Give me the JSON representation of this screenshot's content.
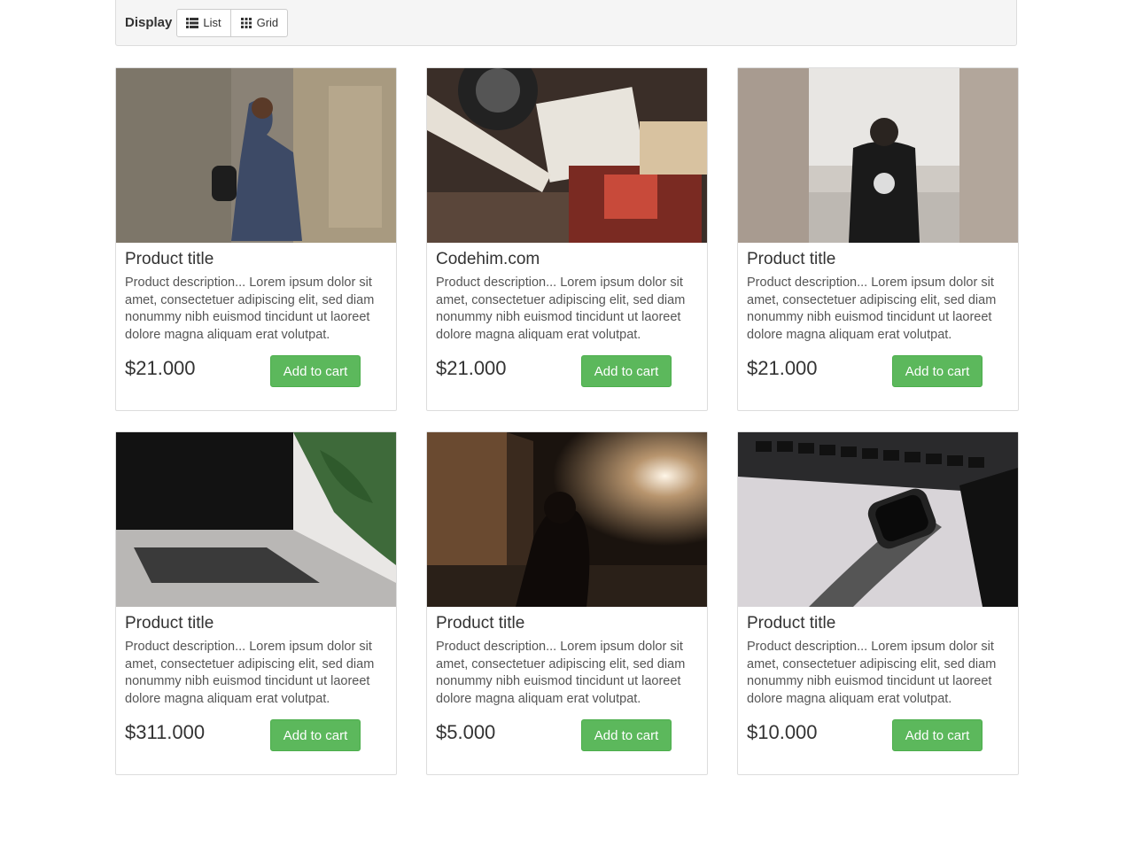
{
  "toolbar": {
    "label": "Display",
    "list_label": "List",
    "grid_label": "Grid",
    "list_icon": "list-icon",
    "grid_icon": "grid-icon"
  },
  "colors": {
    "accent_green": "#5cb85c",
    "toolbar_bg": "#f5f5f5",
    "border": "#dddddd"
  },
  "products": [
    {
      "title": "Product title",
      "description": "Product description... Lorem ipsum dolor sit amet, consectetuer adipiscing elit, sed diam nonummy nibh euismod tincidunt ut laoreet dolore magna aliquam erat volutpat.",
      "price": "$21.000",
      "button": "Add to cart",
      "image": "woman-taking-photo"
    },
    {
      "title": "Codehim.com",
      "description": "Product description... Lorem ipsum dolor sit amet, consectetuer adipiscing elit, sed diam nonummy nibh euismod tincidunt ut laoreet dolore magna aliquam erat volutpat.",
      "price": "$21.000",
      "button": "Add to cart",
      "image": "vinyl-records"
    },
    {
      "title": "Product title",
      "description": "Product description... Lorem ipsum dolor sit amet, consectetuer adipiscing elit, sed diam nonummy nibh euismod tincidunt ut laoreet dolore magna aliquam erat volutpat.",
      "price": "$21.000",
      "button": "Add to cart",
      "image": "man-in-corridor"
    },
    {
      "title": "Product title",
      "description": "Product description... Lorem ipsum dolor sit amet, consectetuer adipiscing elit, sed diam nonummy nibh euismod tincidunt ut laoreet dolore magna aliquam erat volutpat.",
      "price": "$311.000",
      "button": "Add to cart",
      "image": "laptop-and-plant"
    },
    {
      "title": "Product title",
      "description": "Product description... Lorem ipsum dolor sit amet, consectetuer adipiscing elit, sed diam nonummy nibh euismod tincidunt ut laoreet dolore magna aliquam erat volutpat.",
      "price": "$5.000",
      "button": "Add to cart",
      "image": "night-street-silhouette"
    },
    {
      "title": "Product title",
      "description": "Product description... Lorem ipsum dolor sit amet, consectetuer adipiscing elit, sed diam nonummy nibh euismod tincidunt ut laoreet dolore magna aliquam erat volutpat.",
      "price": "$10.000",
      "button": "Add to cart",
      "image": "smartwatch-on-laptop"
    }
  ]
}
